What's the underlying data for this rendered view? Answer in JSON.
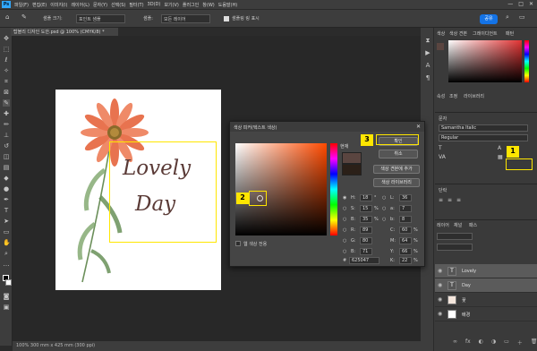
{
  "menubar": {
    "logo": "Ps",
    "items": [
      "파일(F)",
      "편집(E)",
      "이미지(I)",
      "레이어(L)",
      "문자(Y)",
      "선택(S)",
      "필터(T)",
      "3D(D)",
      "보기(V)",
      "플러그인",
      "창(W)",
      "도움말(H)"
    ],
    "controls": [
      "—",
      "□",
      "✕"
    ]
  },
  "options_bar": {
    "sample_size_label": "샘플 크기:",
    "sample_size_value": "포인트 샘플",
    "sample_label": "샘플:",
    "sample_value": "모든 레이어",
    "show_ring_label": "샘플링 링 표시",
    "share_label": "공유"
  },
  "document": {
    "tab_title": "탑블리 디자인 도안.psd @ 100% (CMYK/8) *",
    "lovely_text": "Lovely",
    "day_text": "Day",
    "status_text": "100%   300 mm x 425 mm (300 ppi)"
  },
  "markers": {
    "m1": "1",
    "m2": "2",
    "m3": "3"
  },
  "color_dialog": {
    "title": "색상 피커(텍스트 색상)",
    "ok_label": "확인",
    "cancel_label": "취소",
    "add_swatch_label": "색상 견본에 추가",
    "libraries_label": "색상 라이브러리",
    "new_label": "현재",
    "web_only_label": "웹 색상 전용",
    "hsb": [
      {
        "label": "H:",
        "value": "18",
        "unit": "°"
      },
      {
        "label": "S:",
        "value": "15",
        "unit": "%"
      },
      {
        "label": "B:",
        "value": "35",
        "unit": "%"
      }
    ],
    "rgb": [
      {
        "label": "R:",
        "value": "89"
      },
      {
        "label": "G:",
        "value": "80"
      },
      {
        "label": "B:",
        "value": "71"
      }
    ],
    "lab": [
      {
        "label": "L:",
        "value": "36"
      },
      {
        "label": "a:",
        "value": "7"
      },
      {
        "label": "b:",
        "value": "8"
      }
    ],
    "cmyk": [
      {
        "label": "C:",
        "value": "60",
        "unit": "%"
      },
      {
        "label": "M:",
        "value": "64",
        "unit": "%"
      },
      {
        "label": "Y:",
        "value": "66",
        "unit": "%"
      },
      {
        "label": "K:",
        "value": "22",
        "unit": "%"
      }
    ],
    "hex_label": "#",
    "hex_value": "625047",
    "colors": {
      "new": "#5a4540",
      "current": "#2b2018"
    }
  },
  "right_panel": {
    "color_tabs": [
      "색상",
      "색상 견본",
      "그레이디언트",
      "패턴"
    ],
    "prop_tabs": [
      "속성",
      "조정",
      "라이브러리"
    ],
    "text_section": "문자",
    "font_name": "Samantha Italic",
    "font_style": "Regular",
    "para_section": "단락",
    "layers_tabs": [
      "레이어",
      "채널",
      "패스"
    ],
    "layers": [
      {
        "name": "Lovely",
        "kind": "T",
        "selected": true
      },
      {
        "name": "Day",
        "kind": "T",
        "selected": true
      },
      {
        "name": "꽃",
        "kind": "img",
        "selected": false
      },
      {
        "name": "배경",
        "kind": "bg",
        "selected": false
      }
    ]
  }
}
